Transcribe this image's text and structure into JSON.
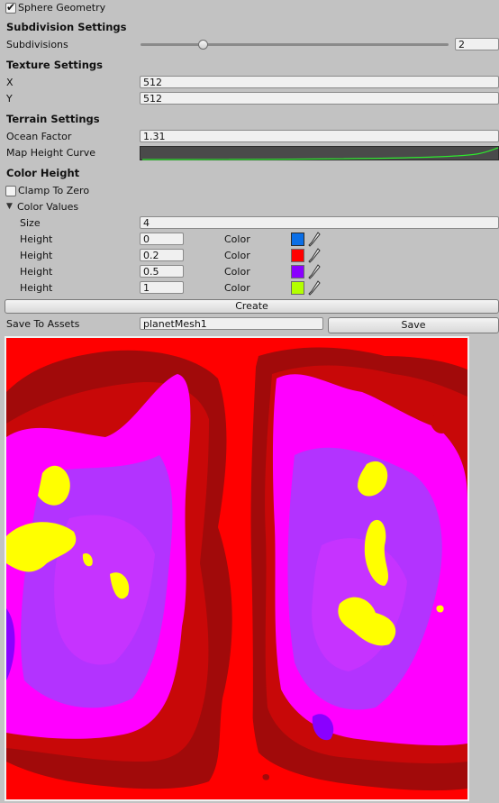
{
  "sphere_geometry": {
    "label": "Sphere Geometry",
    "checked": true
  },
  "subdivision": {
    "header": "Subdivision Settings",
    "label": "Subdivisions",
    "value": "2",
    "slider_fraction": 0.2
  },
  "texture": {
    "header": "Texture Settings",
    "x_label": "X",
    "x_value": "512",
    "y_label": "Y",
    "y_value": "512"
  },
  "terrain": {
    "header": "Terrain Settings",
    "ocean_label": "Ocean Factor",
    "ocean_value": "1.31",
    "curve_label": "Map Height Curve"
  },
  "color_height": {
    "header": "Color Height",
    "clamp_label": "Clamp To Zero",
    "clamp_checked": false,
    "values_label": "Color Values",
    "size_label": "Size",
    "size_value": "4",
    "height_label": "Height",
    "color_label": "Color",
    "entries": [
      {
        "height": "0",
        "color": "#0a6ee6"
      },
      {
        "height": "0.2",
        "color": "#ff0000"
      },
      {
        "height": "0.5",
        "color": "#8a00ff"
      },
      {
        "height": "1",
        "color": "#b3ff00"
      }
    ]
  },
  "actions": {
    "create_label": "Create",
    "save_assets_label": "Save To Assets",
    "asset_name": "planetMesh1",
    "save_label": "Save"
  }
}
